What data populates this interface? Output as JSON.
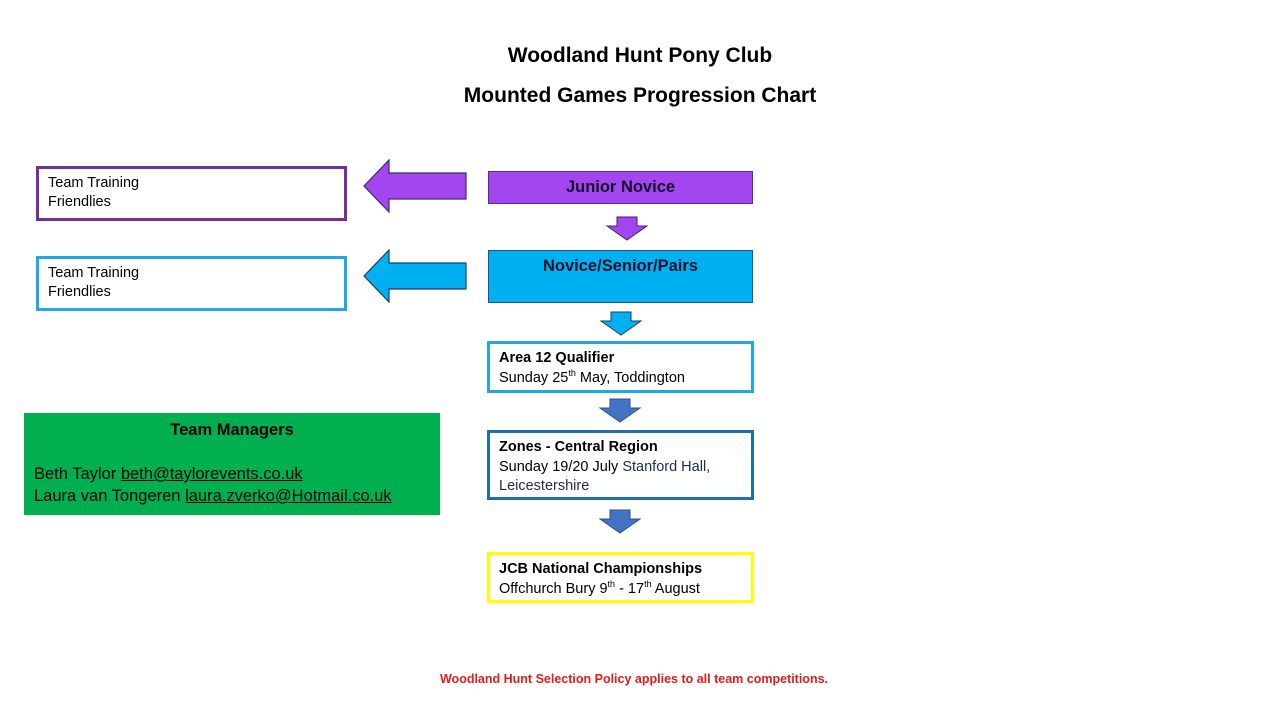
{
  "header": {
    "title": "Woodland Hunt Pony Club",
    "subtitle": "Mounted Games Progression Chart"
  },
  "side_boxes": [
    {
      "line1": "Team Training",
      "line2": "Friendlies",
      "color": "#7030a0"
    },
    {
      "line1": "Team Training",
      "line2": "Friendlies",
      "color": "#1fa9e1"
    }
  ],
  "stages": {
    "junior": {
      "label": "Junior Novice",
      "fill": "#a346f0"
    },
    "nsp": {
      "label": "Novice/Senior/Pairs",
      "fill": "#00b0f0"
    }
  },
  "events": {
    "area12": {
      "name": "Area 12 Qualifier",
      "date_prefix": "Sunday 25",
      "date_sup": "th",
      "date_suffix": " May, Toddington",
      "border": "#1fa9e1"
    },
    "zones": {
      "name": "Zones - Central Region",
      "line_a": "Sunday 19/20 July ",
      "line_b": "Stanford Hall,",
      "line_c": "Leicestershire",
      "border": "#1f6fb0"
    },
    "jcb": {
      "name": "JCB National Championships",
      "p1": "Offchurch Bury 9",
      "sup1": "th",
      "p2": " - 17",
      "sup2": "th",
      "p3": " August",
      "border": "#ffff00"
    }
  },
  "managers": {
    "heading": "Team Managers",
    "people": [
      {
        "name": "Beth Taylor ",
        "email": "beth@taylorevents.co.uk"
      },
      {
        "name": "Laura van Tongeren ",
        "email": "laura.zverko@Hotmail.co.uk"
      }
    ],
    "fill": "#00b050"
  },
  "footer": {
    "note": "Woodland Hunt Selection Policy applies to all team competitions."
  },
  "icons": {
    "left_arrow": "left-arrow-icon",
    "down_arrow": "down-arrow-icon"
  }
}
